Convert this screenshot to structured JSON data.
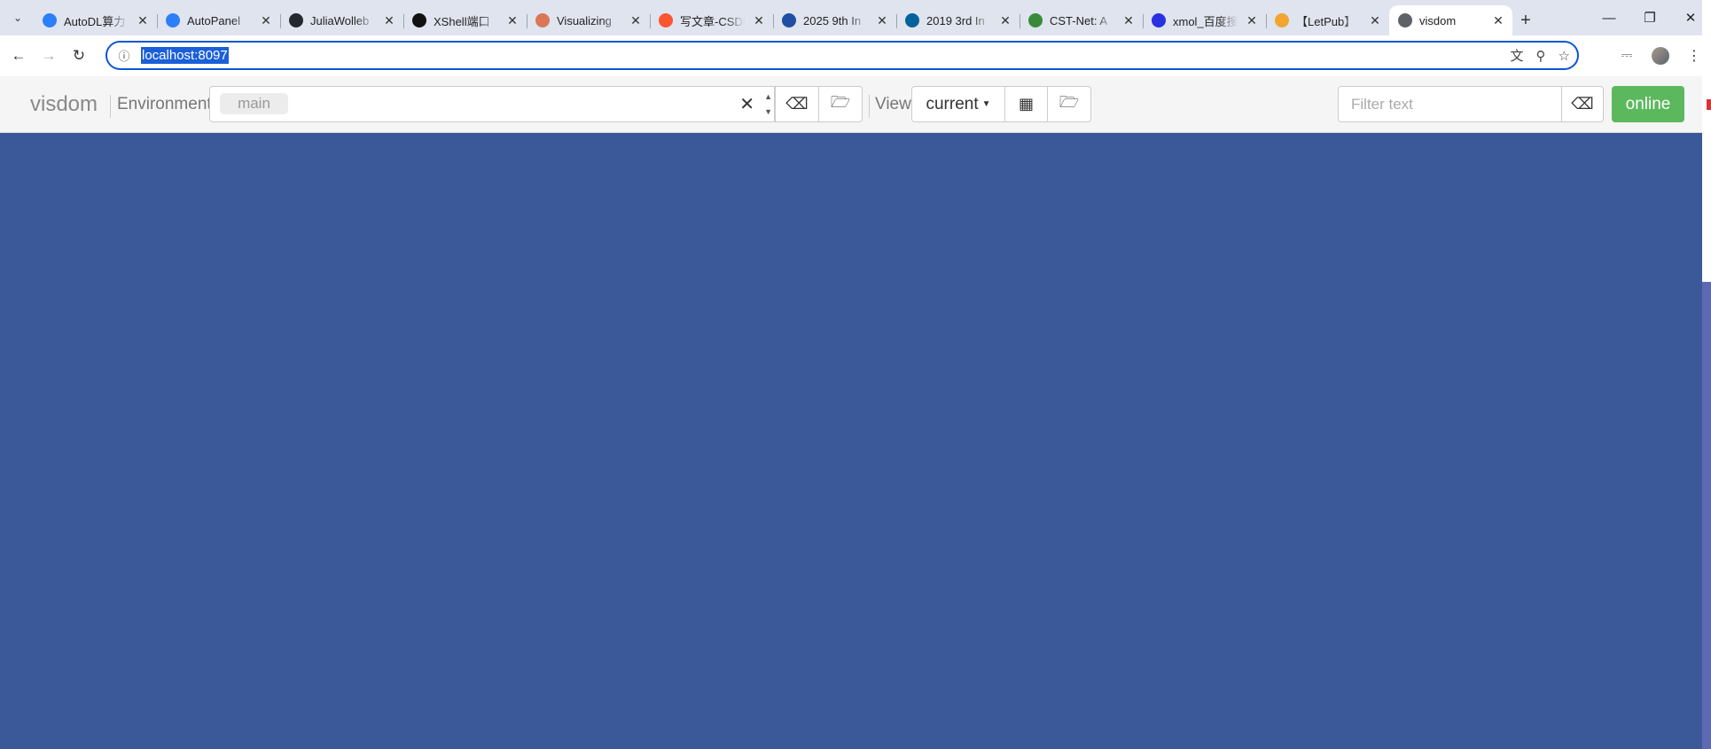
{
  "browser": {
    "tabs": [
      {
        "title": "AutoDL算力",
        "icon": "autodl-icon",
        "color": "#2d7ff9"
      },
      {
        "title": "AutoPanel",
        "icon": "autodl-icon",
        "color": "#2d7ff9"
      },
      {
        "title": "JuliaWolleb",
        "icon": "github-icon",
        "color": "#24292f"
      },
      {
        "title": "XShell端口",
        "icon": "openai-icon",
        "color": "#111111"
      },
      {
        "title": "Visualizing",
        "icon": "claude-icon",
        "color": "#d97757"
      },
      {
        "title": "写文章-CSDN",
        "icon": "csdn-icon",
        "color": "#fc5531"
      },
      {
        "title": "2025 9th In",
        "icon": "conference-icon",
        "color": "#1e4fa3"
      },
      {
        "title": "2019 3rd In",
        "icon": "ieee-icon",
        "color": "#00629b"
      },
      {
        "title": "CST-Net: A",
        "icon": "paper-icon",
        "color": "#3a8a3a"
      },
      {
        "title": "xmol_百度搜",
        "icon": "baidu-icon",
        "color": "#2932e1"
      },
      {
        "title": "【LetPub】",
        "icon": "letpub-icon",
        "color": "#f2a531"
      },
      {
        "title": "visdom",
        "icon": "globe-icon",
        "color": "#5f6368",
        "active": true
      }
    ],
    "url": "localhost:8097"
  },
  "visdom": {
    "brand": "visdom",
    "environment_label": "Environment",
    "environment_tag": "main",
    "view_label": "View",
    "view_selected": "current",
    "filter_placeholder": "Filter text",
    "status": "online"
  },
  "colors": {
    "canvas": "#3b5998",
    "online": "#5cb85c",
    "navbar": "#f5f5f5"
  }
}
